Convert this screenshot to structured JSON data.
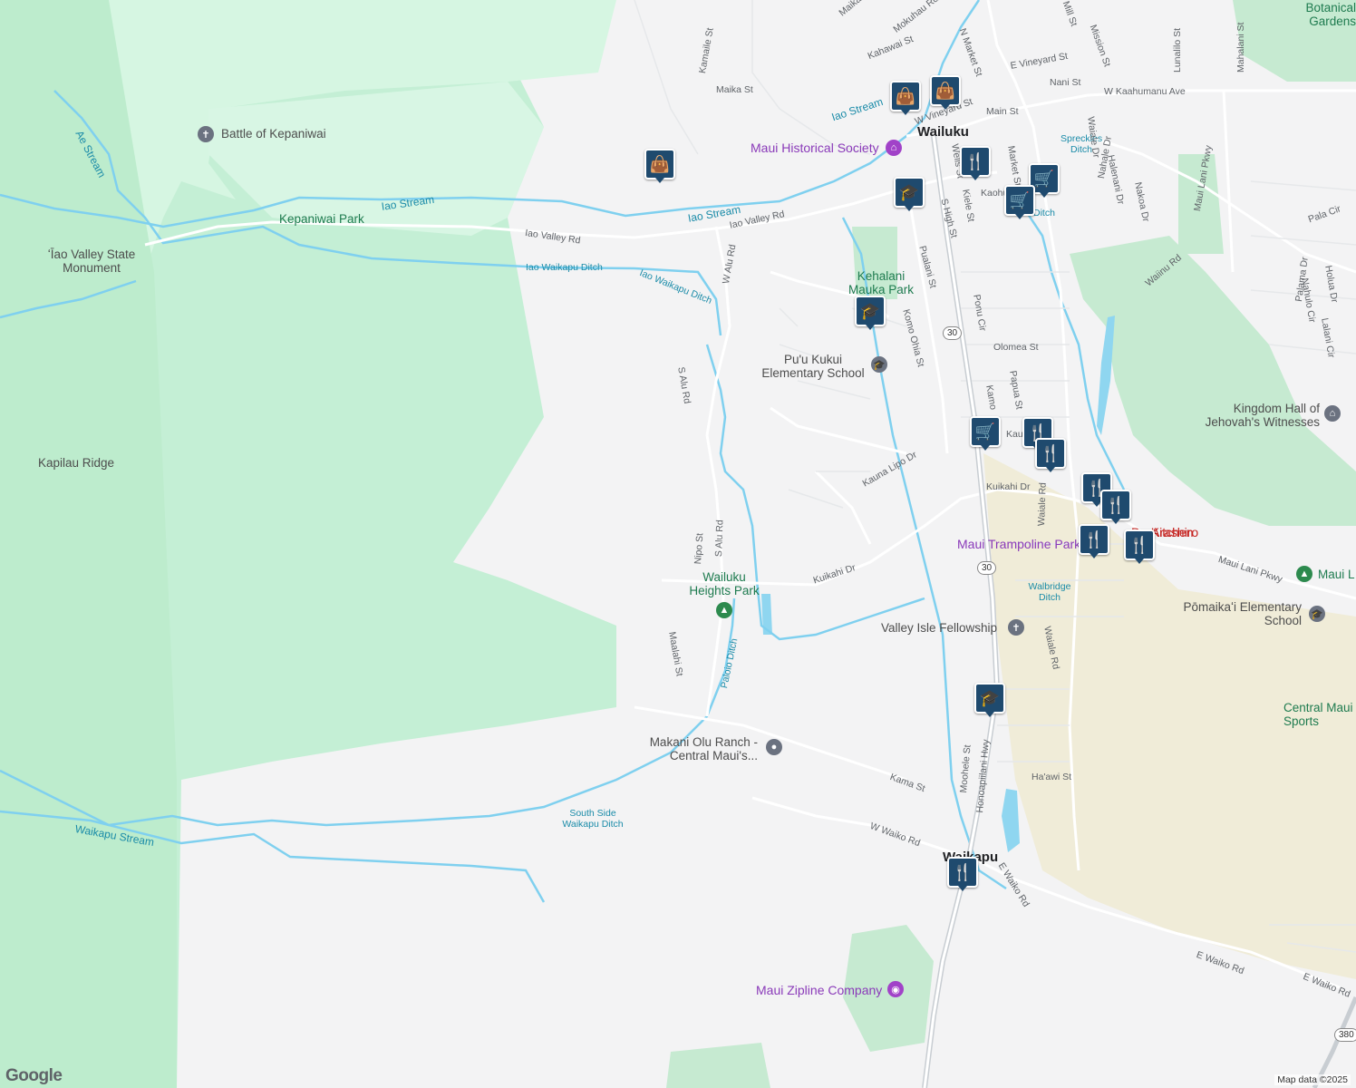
{
  "map": {
    "areas": [
      "Kapilau Ridge"
    ],
    "towns": [
      "Wailuku",
      "Waikapu"
    ],
    "places": [
      "Battle of Kepaniwai",
      "Kepaniwai Park",
      "ʻĪao Valley State Monument",
      "Maui Historical Society",
      "Kehalani Mauka Park",
      "Pu'u Kukui Elementary School",
      "Kingdom Hall of Jehovah's Witnesses",
      "Maui Trampoline Park",
      "Wailuku Heights Park",
      "Valley Isle Fellowship",
      "Makani Olu Ranch - Central Maui's...",
      "Pōmaikaʻi Elementary School",
      "Central Maui Sports",
      "Maui Zipline Company",
      "Botanical Gardens",
      "Maui L",
      "Da Kitchen",
      "Arashiro"
    ],
    "waterways": [
      "Iao Stream",
      "Iao Stream",
      "Iao Stream",
      "Ae Stream",
      "Iao Waikapu Ditch",
      "Iao Waikapu Ditch",
      "Paloio Ditch",
      "South Side Waikapu Ditch",
      "Waikapu Stream",
      "Walbridge Ditch",
      "Spreckles Ditch",
      "Ditch"
    ],
    "streets": [
      "Iao Valley Rd",
      "Iao Valley Rd",
      "W Alu Rd",
      "S Alu Rd",
      "S Alu Rd",
      "Nipo St",
      "Maalahi St",
      "Kuikahi Dr",
      "Kuikahi Dr",
      "Kauna Lipo Dr",
      "Komo Ohia St",
      "Pualani St",
      "S High St",
      "Honoapiilani Hwy",
      "Kama St",
      "W Waiko Rd",
      "E Waiko Rd",
      "E Waiko Rd",
      "E Waiko Rd",
      "Waiale Rd",
      "Waiale Rd",
      "Waiale Dr",
      "Main St",
      "W Kaahumanu Ave",
      "Mill St",
      "Mission St",
      "E Vineyard St",
      "Nani St",
      "N Market St",
      "Market St",
      "Kaohu St",
      "Kahawai St",
      "Mokuhau Rd",
      "Maika St",
      "Maika St",
      "Kamaile St",
      "Lunalilo St",
      "Mahalani St",
      "Maui Lani Pkwy",
      "Maui Lani Pkwy",
      "Pala Cir",
      "Nahale Dr",
      "Halenani Dr",
      "Nakoa Dr",
      "Palama Dr",
      "Lalani Cir",
      "Holua Dr",
      "Nahulo Cir",
      "Waiinu Rd",
      "Olomea St",
      "Ponu Cir",
      "Papua St",
      "Kamo",
      "Kau",
      "Moohele St",
      "Ha'awi St",
      "Kiele St",
      "Wells St",
      "W Vineyard St"
    ],
    "route_shields": [
      "30",
      "30",
      "380"
    ],
    "markers": [
      {
        "type": "shopping",
        "icon": "shopping-bag-icon",
        "glyph": "👜"
      },
      {
        "type": "shopping",
        "icon": "shopping-bag-icon",
        "glyph": "👜"
      },
      {
        "type": "shopping",
        "icon": "shopping-bag-icon",
        "glyph": "👜"
      },
      {
        "type": "restaurant",
        "icon": "fork-knife-icon",
        "glyph": "🍴"
      },
      {
        "type": "grocery",
        "icon": "shopping-cart-icon",
        "glyph": "🛒"
      },
      {
        "type": "grocery",
        "icon": "shopping-cart-icon",
        "glyph": "🛒"
      },
      {
        "type": "school",
        "icon": "graduation-cap-icon",
        "glyph": "🎓"
      },
      {
        "type": "school",
        "icon": "graduation-cap-icon",
        "glyph": "🎓"
      },
      {
        "type": "grocery",
        "icon": "shopping-cart-icon",
        "glyph": "🛒"
      },
      {
        "type": "restaurant",
        "icon": "fork-knife-icon",
        "glyph": "🍴"
      },
      {
        "type": "restaurant",
        "icon": "fork-knife-icon",
        "glyph": "🍴"
      },
      {
        "type": "restaurant",
        "icon": "fork-knife-icon",
        "glyph": "🍴"
      },
      {
        "type": "restaurant",
        "icon": "fork-knife-icon",
        "glyph": "🍴"
      },
      {
        "type": "restaurant",
        "icon": "fork-knife-icon",
        "glyph": "🍴"
      },
      {
        "type": "restaurant",
        "icon": "fork-knife-icon",
        "glyph": "🍴"
      },
      {
        "type": "school",
        "icon": "graduation-cap-icon",
        "glyph": "🎓"
      },
      {
        "type": "restaurant",
        "icon": "fork-knife-icon",
        "glyph": "🍴"
      }
    ]
  },
  "logo": "Google",
  "attribution": "Map data ©2025"
}
